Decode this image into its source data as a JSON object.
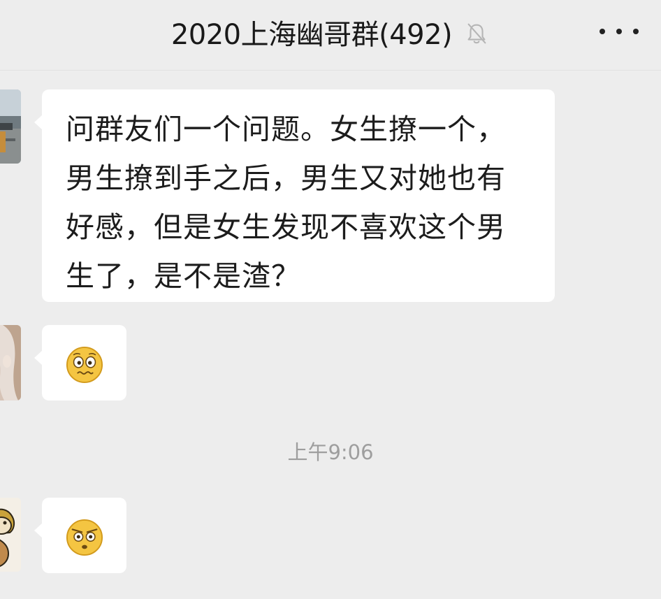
{
  "header": {
    "title": "2020上海幽哥群(492)",
    "mute_icon": "bell-muted-icon",
    "more_icon": "more-dots-icon"
  },
  "messages": [
    {
      "type": "text",
      "avatar_icon": "avatar-scenery",
      "text": "问群友们一个问题。女生撩一个，\n男生撩到手之后，男生又对她也有\n好感，但是女生发现不喜欢这个男\n生了，是不是渣？"
    },
    {
      "type": "emoji",
      "avatar_icon": "avatar-girl",
      "emoji": "awkward-face-emoji"
    },
    {
      "type": "emoji",
      "avatar_icon": "avatar-cartoon-dog",
      "emoji": "eye-roll-face-emoji"
    }
  ],
  "timestamp": "上午9:06",
  "colors": {
    "background": "#ededed",
    "bubble": "#ffffff",
    "title_text": "#191919",
    "message_text": "#1c1c1c",
    "timestamp_text": "#9e9e9e"
  }
}
